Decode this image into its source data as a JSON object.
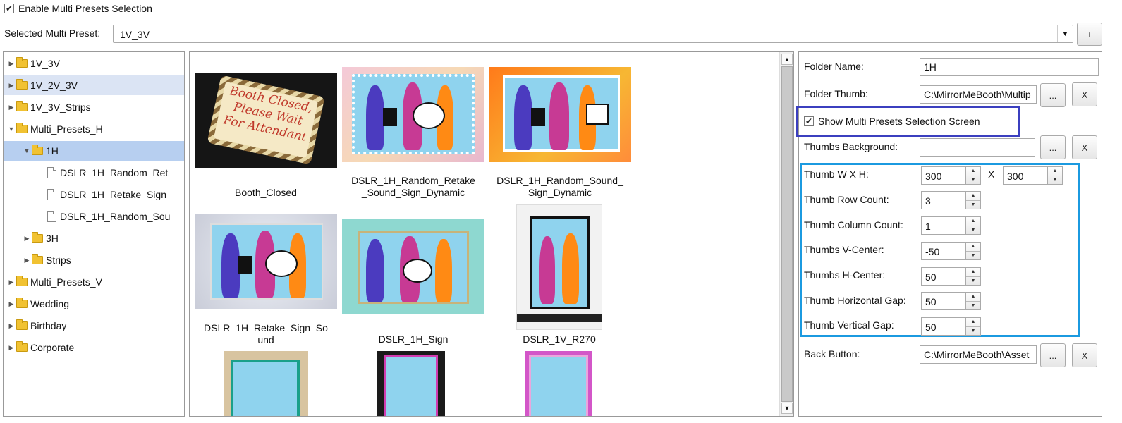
{
  "enable_multi": {
    "label": "Enable Multi Presets Selection",
    "checked": true
  },
  "selected_preset": {
    "label": "Selected Multi Preset:",
    "value": "1V_3V",
    "add_label": "+"
  },
  "tree": {
    "items": [
      {
        "label": "1V_3V",
        "type": "folder",
        "expanded": false
      },
      {
        "label": "1V_2V_3V",
        "type": "folder",
        "expanded": false,
        "hover": true
      },
      {
        "label": "1V_3V_Strips",
        "type": "folder",
        "expanded": false
      },
      {
        "label": "Multi_Presets_H",
        "type": "folder",
        "expanded": true
      },
      {
        "label": "1H",
        "type": "folder",
        "expanded": true,
        "selected": true
      },
      {
        "label": "DSLR_1H_Random_Ret",
        "type": "file"
      },
      {
        "label": "DSLR_1H_Retake_Sign_",
        "type": "file"
      },
      {
        "label": "DSLR_1H_Random_Sou",
        "type": "file"
      },
      {
        "label": "3H",
        "type": "folder",
        "expanded": false
      },
      {
        "label": "Strips",
        "type": "folder",
        "expanded": false
      },
      {
        "label": "Multi_Presets_V",
        "type": "folder",
        "expanded": false
      },
      {
        "label": "Wedding",
        "type": "folder",
        "expanded": false
      },
      {
        "label": "Birthday",
        "type": "folder",
        "expanded": false
      },
      {
        "label": "Corporate",
        "type": "folder",
        "expanded": false
      }
    ]
  },
  "thumbs": {
    "items": [
      {
        "caption": "Booth_Closed",
        "sign_text": [
          "Booth Closed,",
          "Please Wait",
          "For Attendant"
        ]
      },
      {
        "caption": "DSLR_1H_Random_Retake\n_Sound_Sign_Dynamic"
      },
      {
        "caption": "DSLR_1H_Random_Sound_\nSign_Dynamic"
      },
      {
        "caption": "DSLR_1H_Retake_Sign_So\nund"
      },
      {
        "caption": "DSLR_1H_Sign"
      },
      {
        "caption": "DSLR_1V_R270"
      }
    ]
  },
  "settings": {
    "folder_name": {
      "label": "Folder Name:",
      "value": "1H"
    },
    "folder_thumb": {
      "label": "Folder Thumb:",
      "value": "C:\\MirrorMeBooth\\Multip",
      "browse": "...",
      "clear": "X"
    },
    "show_selection": {
      "label": "Show Multi Presets Selection Screen",
      "checked": true
    },
    "thumbs_background": {
      "label": "Thumbs Background:",
      "value": "",
      "browse": "...",
      "clear": "X"
    },
    "thumb_wxh": {
      "label": "Thumb W X H:",
      "w": "300",
      "x_label": "X",
      "h": "300"
    },
    "thumb_row_count": {
      "label": "Thumb Row Count:",
      "value": "3"
    },
    "thumb_column_count": {
      "label": "Thumb Column Count:",
      "value": "1"
    },
    "thumbs_v_center": {
      "label": "Thumbs V-Center:",
      "value": "-50"
    },
    "thumbs_h_center": {
      "label": "Thumbs H-Center:",
      "value": "50"
    },
    "thumb_h_gap": {
      "label": "Thumb Horizontal Gap:",
      "value": "50"
    },
    "thumb_v_gap": {
      "label": "Thumb Vertical Gap:",
      "value": "50"
    },
    "back_button": {
      "label": "Back Button:",
      "value": "C:\\MirrorMeBooth\\Asset",
      "browse": "...",
      "clear": "X"
    }
  },
  "colors": {
    "highlight_dark": "#3b3fbf",
    "highlight_light": "#1b9ae0",
    "tree_selected": "#b7cff0",
    "tree_hover": "#dbe4f4"
  }
}
